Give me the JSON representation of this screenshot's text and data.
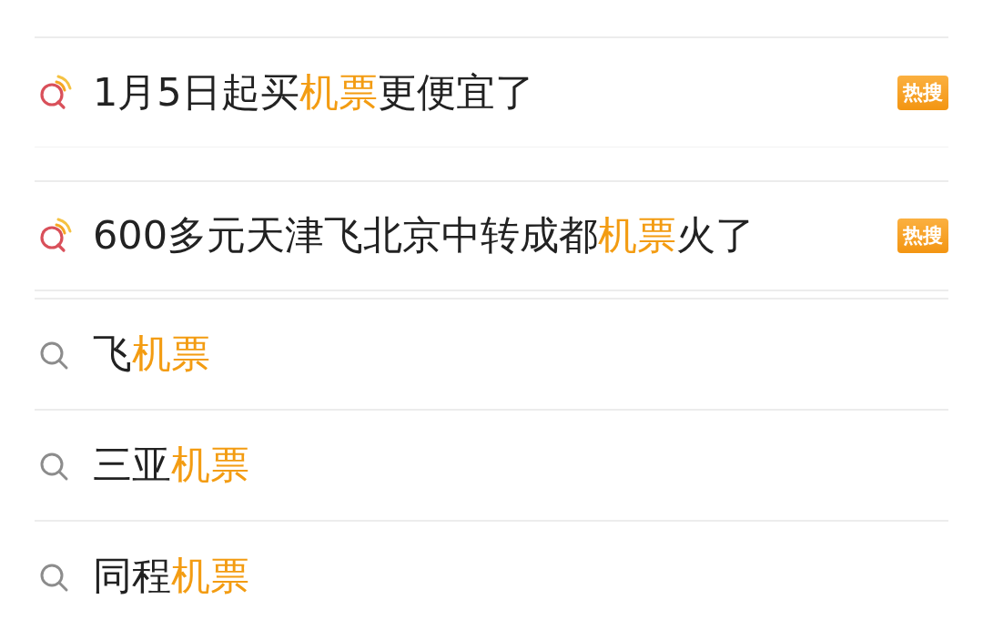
{
  "suggestions": [
    {
      "kind": "hot",
      "parts": [
        {
          "text": "1月5日起买",
          "highlight": false
        },
        {
          "text": "机票",
          "highlight": true
        },
        {
          "text": "更便宜了",
          "highlight": false
        }
      ],
      "badge": "热搜"
    },
    {
      "kind": "hot",
      "parts": [
        {
          "text": "600多元天津飞北京中转成都",
          "highlight": false
        },
        {
          "text": "机票",
          "highlight": true
        },
        {
          "text": "火了",
          "highlight": false
        }
      ],
      "badge": "热搜"
    },
    {
      "kind": "plain",
      "parts": [
        {
          "text": "飞",
          "highlight": false
        },
        {
          "text": "机票",
          "highlight": true
        }
      ]
    },
    {
      "kind": "plain",
      "parts": [
        {
          "text": "三亚",
          "highlight": false
        },
        {
          "text": "机票",
          "highlight": true
        }
      ]
    },
    {
      "kind": "plain",
      "parts": [
        {
          "text": "同程",
          "highlight": false
        },
        {
          "text": "机票",
          "highlight": true
        }
      ]
    }
  ]
}
